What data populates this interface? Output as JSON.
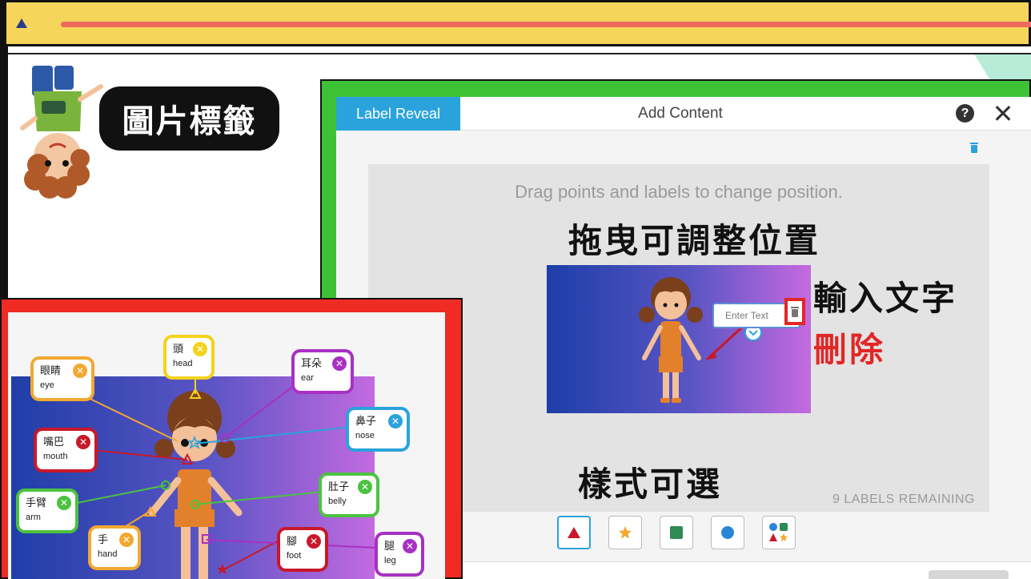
{
  "slide": {
    "title": "圖片標籤"
  },
  "editor": {
    "tab_label": "Label Reveal",
    "header_title": "Add Content",
    "help_glyph": "?",
    "close_glyph": "✕",
    "hint": "Drag points and labels to change position.",
    "remaining": "9 LABELS REMAINING",
    "input_placeholder": "Enter Text",
    "shape_options": [
      "triangle",
      "star",
      "square",
      "circle",
      "mixed"
    ]
  },
  "annotations": {
    "drag": "拖曳可調整位置",
    "input": "輸入文字",
    "delete": "刪除",
    "style": "樣式可選"
  },
  "sample_labels": [
    {
      "zh": "眼睛",
      "en": "eye",
      "color": "orange"
    },
    {
      "zh": "頭",
      "en": "head",
      "color": "yellow"
    },
    {
      "zh": "耳朵",
      "en": "ear",
      "color": "purple"
    },
    {
      "zh": "鼻子",
      "en": "nose",
      "color": "blue"
    },
    {
      "zh": "嘴巴",
      "en": "mouth",
      "color": "red"
    },
    {
      "zh": "肚子",
      "en": "belly",
      "color": "green"
    },
    {
      "zh": "手臂",
      "en": "arm",
      "color": "green"
    },
    {
      "zh": "手",
      "en": "hand",
      "color": "orange"
    },
    {
      "zh": "腳",
      "en": "foot",
      "color": "red"
    },
    {
      "zh": "腿",
      "en": "leg",
      "color": "purple"
    }
  ],
  "colors": {
    "accent_blue": "#2aa3dc",
    "frame_green": "#3ec235",
    "frame_red": "#ef2b24",
    "topbar_yellow": "#f6d65a",
    "delete_red": "#e32626"
  }
}
